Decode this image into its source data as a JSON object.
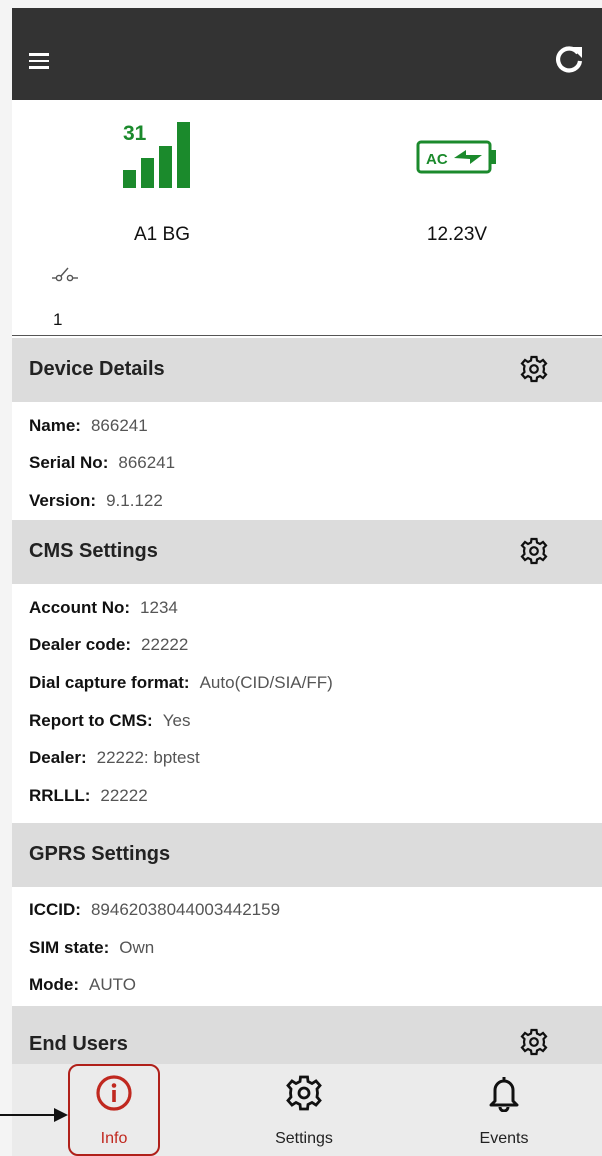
{
  "status": {
    "signal_strength": "31",
    "operator": "A1 BG",
    "power_icon_text": "AC",
    "voltage": "12.23V",
    "switch_count": "1"
  },
  "device_details": {
    "title": "Device Details",
    "rows": [
      {
        "label": "Name:",
        "value": "866241"
      },
      {
        "label": "Serial No:",
        "value": "866241"
      },
      {
        "label": "Version:",
        "value": "9.1.122"
      }
    ]
  },
  "cms_settings": {
    "title": "CMS Settings",
    "rows": [
      {
        "label": "Account No:",
        "value": "1234"
      },
      {
        "label": "Dealer code:",
        "value": "22222"
      },
      {
        "label": "Dial capture format:",
        "value": "Auto(CID/SIA/FF)"
      },
      {
        "label": "Report to CMS:",
        "value": "Yes"
      },
      {
        "label": "Dealer:",
        "value": "22222: bptest"
      },
      {
        "label": "RRLLL:",
        "value": "22222"
      }
    ]
  },
  "gprs_settings": {
    "title": "GPRS Settings",
    "rows": [
      {
        "label": "ICCID:",
        "value": "89462038044003442159"
      },
      {
        "label": "SIM state:",
        "value": "Own"
      },
      {
        "label": "Mode:",
        "value": "AUTO"
      }
    ]
  },
  "end_users": {
    "title": "End Users"
  },
  "bottom_nav": {
    "items": [
      {
        "label": "Info",
        "icon": "info-icon"
      },
      {
        "label": "Settings",
        "icon": "gear-icon"
      },
      {
        "label": "Events",
        "icon": "bell-icon"
      }
    ]
  },
  "colors": {
    "appbar": "#333333",
    "signal_green": "#1b8a2c",
    "section_header": "#dcdcdc",
    "highlight_red": "#b0201a"
  }
}
